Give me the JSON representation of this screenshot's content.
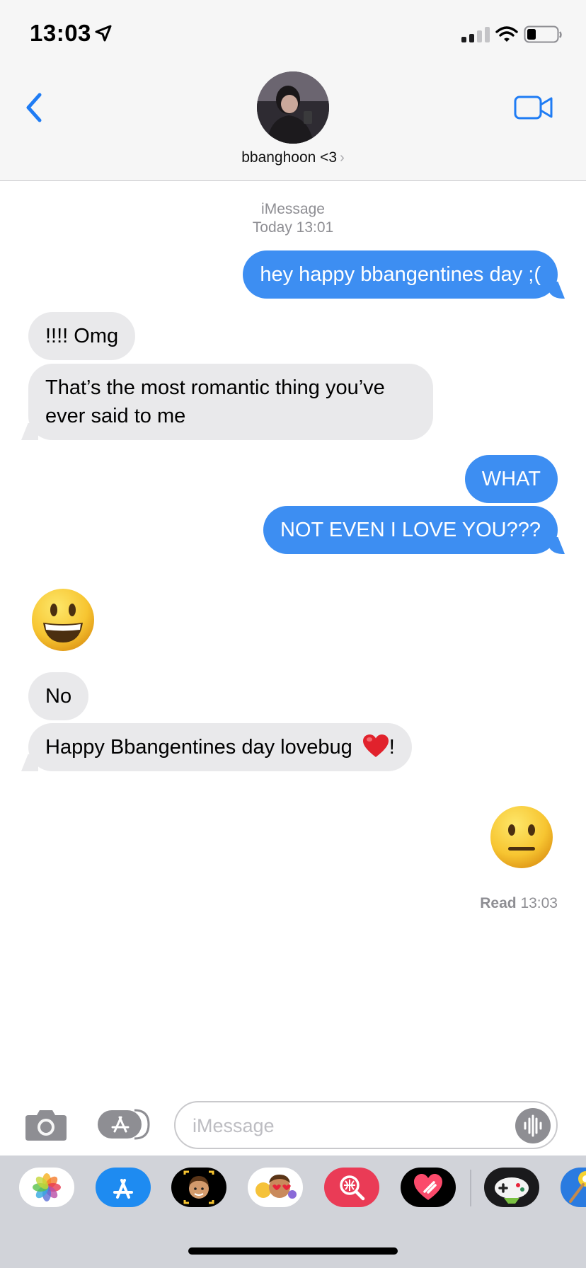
{
  "status_bar": {
    "time": "13:03"
  },
  "header": {
    "contact_name": "bbanghoon <3",
    "chevron": "›"
  },
  "thread": {
    "service_label": "iMessage",
    "timestamp": "Today 13:01",
    "messages": [
      {
        "direction": "sent",
        "text": "hey happy bbangentines day ;("
      },
      {
        "direction": "received",
        "text": "!!!! Omg"
      },
      {
        "direction": "received",
        "text": "That’s the most romantic thing you’ve ever said to me"
      },
      {
        "direction": "sent",
        "text": "WHAT"
      },
      {
        "direction": "sent",
        "text": "NOT EVEN I LOVE YOU???"
      },
      {
        "direction": "received",
        "emoji": "grinning-face"
      },
      {
        "direction": "received",
        "text": "No"
      },
      {
        "direction": "received",
        "text": "Happy Bbangentines day lovebug",
        "suffix": "!"
      },
      {
        "direction": "sent",
        "emoji": "neutral-face"
      }
    ],
    "read_label": "Read",
    "read_time": "13:03"
  },
  "compose": {
    "placeholder": "iMessage",
    "value": ""
  },
  "drawer": {
    "apps": [
      "photos-app-icon",
      "app-store-app-icon",
      "memoji-app-icon",
      "animoji-stickers-app-icon",
      "web-images-app-icon",
      "digital-touch-app-icon",
      "game-app-icon",
      "pool-game-app-icon"
    ]
  },
  "colors": {
    "sent_bubble": "#3d8ef2",
    "received_bubble": "#e9e9eb",
    "ios_blue": "#1f7cf4",
    "header_bg": "#f6f6f6",
    "drawer_bg": "#d1d3d9"
  }
}
